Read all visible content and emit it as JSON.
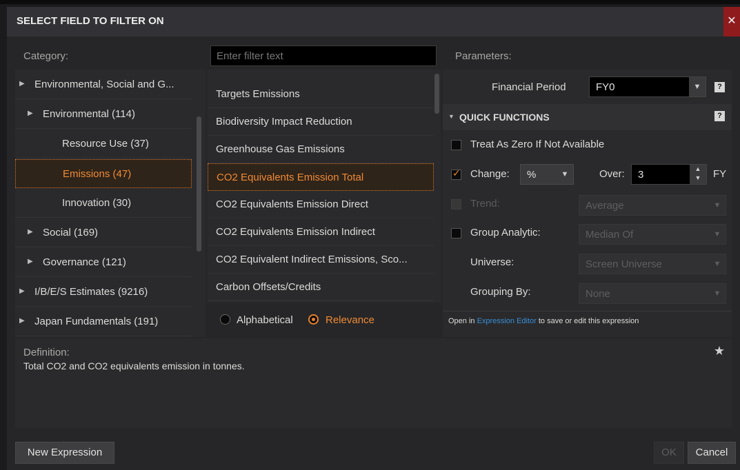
{
  "title": "SELECT FIELD TO FILTER ON",
  "category_header": "Category:",
  "parameters_header": "Parameters:",
  "filter_placeholder": "Enter filter text",
  "categories": [
    {
      "label": "Environmental, Social and G...",
      "level": 0,
      "expandable": true
    },
    {
      "label": "Environmental (114)",
      "level": 1,
      "expandable": true
    },
    {
      "label": "Resource Use (37)",
      "level": 2,
      "expandable": false
    },
    {
      "label": "Emissions (47)",
      "level": 2,
      "expandable": false,
      "selected": true
    },
    {
      "label": "Innovation (30)",
      "level": 2,
      "expandable": false
    },
    {
      "label": "Social (169)",
      "level": 1,
      "expandable": true
    },
    {
      "label": "Governance (121)",
      "level": 1,
      "expandable": true
    },
    {
      "label": "I/B/E/S Estimates (9216)",
      "level": 0,
      "expandable": true
    },
    {
      "label": "Japan Fundamentals (191)",
      "level": 0,
      "expandable": true
    }
  ],
  "fields": [
    {
      "label": "Targets Emissions"
    },
    {
      "label": "Biodiversity Impact Reduction"
    },
    {
      "label": "Greenhouse Gas Emissions"
    },
    {
      "label": "CO2 Equivalents Emission Total",
      "selected": true
    },
    {
      "label": "CO2 Equivalents Emission Direct"
    },
    {
      "label": "CO2 Equivalents Emission Indirect"
    },
    {
      "label": "CO2 Equivalent Indirect Emissions, Sco..."
    },
    {
      "label": "Carbon Offsets/Credits"
    }
  ],
  "sort": {
    "alphabetical": "Alphabetical",
    "relevance": "Relevance",
    "selected": "relevance"
  },
  "params": {
    "financial_period_label": "Financial Period",
    "financial_period_value": "FY0",
    "quick_functions_label": "QUICK FUNCTIONS",
    "treat_zero_label": "Treat As Zero If Not Available",
    "change_label": "Change:",
    "change_value": "%",
    "over_label": "Over:",
    "over_value": "3",
    "over_unit": "FY",
    "trend_label": "Trend:",
    "trend_value": "Average",
    "group_label": "Group Analytic:",
    "group_value": "Median Of",
    "universe_label": "Universe:",
    "universe_value": "Screen Universe",
    "grouping_label": "Grouping By:",
    "grouping_value": "None",
    "expr_prefix": "Open in",
    "expr_link": "Expression Editor",
    "expr_suffix": "to save or edit this expression"
  },
  "definition": {
    "label": "Definition:",
    "text": "Total CO2 and CO2 equivalents emission in tonnes."
  },
  "buttons": {
    "new_expression": "New Expression",
    "ok": "OK",
    "cancel": "Cancel"
  },
  "colors": {
    "accent": "#e7822e",
    "link": "#3a8fd6",
    "close_bg": "#8f1b1d"
  }
}
